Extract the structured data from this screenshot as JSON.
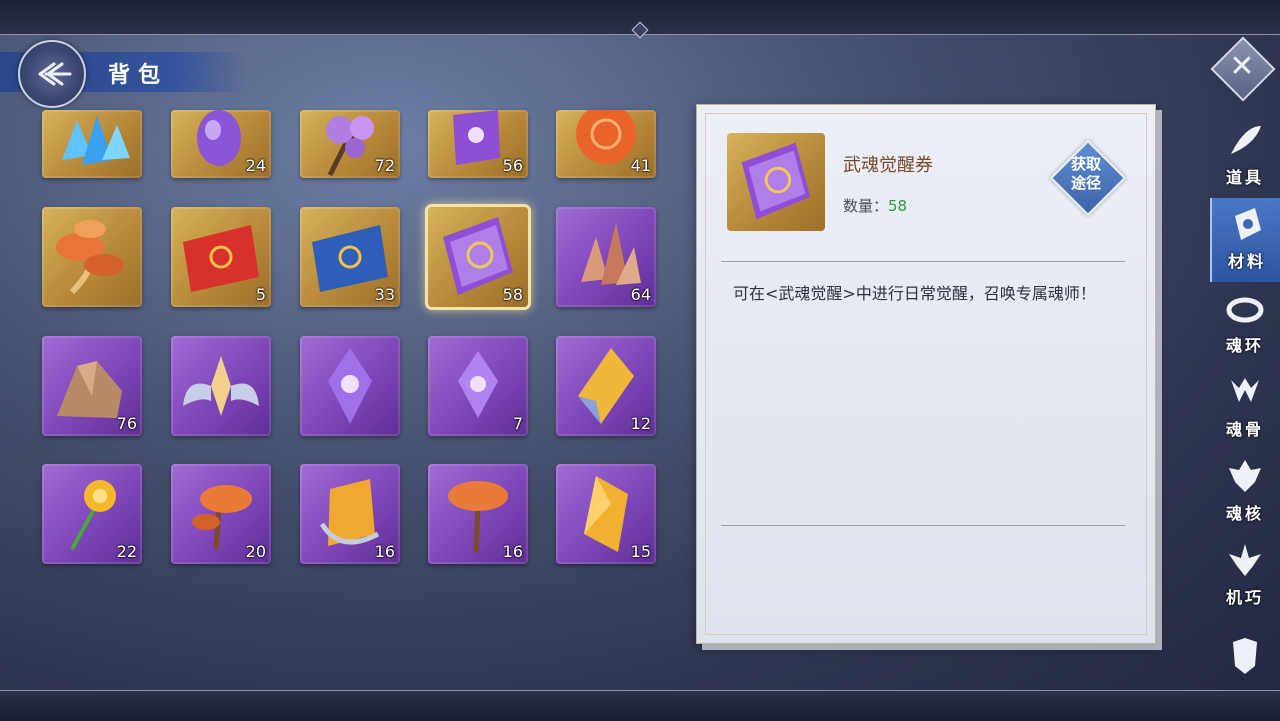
{
  "header": {
    "title": "背包"
  },
  "inventory": {
    "row0": [
      {
        "icon": "blue-crystal-cluster-icon",
        "count": "",
        "bg": "gold"
      },
      {
        "icon": "purple-gem-icon",
        "count": "24",
        "bg": "gold"
      },
      {
        "icon": "purple-flower-branch-icon",
        "count": "72",
        "bg": "gold"
      },
      {
        "icon": "purple-card-icon",
        "count": "56",
        "bg": "gold"
      },
      {
        "icon": "orange-orb-icon",
        "count": "41",
        "bg": "gold"
      }
    ],
    "row1": [
      {
        "icon": "mushroom-cluster-icon",
        "count": "",
        "bg": "gold"
      },
      {
        "icon": "red-scroll-icon",
        "count": "5",
        "bg": "gold"
      },
      {
        "icon": "blue-scroll-icon",
        "count": "33",
        "bg": "gold"
      },
      {
        "icon": "awakening-ticket-icon",
        "count": "58",
        "bg": "gold"
      },
      {
        "icon": "copper-crystal-icon",
        "count": "64",
        "bg": "purple"
      }
    ],
    "row2": [
      {
        "icon": "ore-rock-icon",
        "count": "76",
        "bg": "purple"
      },
      {
        "icon": "winged-emblem-icon",
        "count": "",
        "bg": "purple"
      },
      {
        "icon": "purple-shard-icon",
        "count": "",
        "bg": "purple"
      },
      {
        "icon": "purple-shard-small-icon",
        "count": "7",
        "bg": "purple"
      },
      {
        "icon": "golden-crystal-icon",
        "count": "12",
        "bg": "purple"
      }
    ],
    "row3": [
      {
        "icon": "golden-flower-icon",
        "count": "22",
        "bg": "purple"
      },
      {
        "icon": "lingzhi-mushroom-icon",
        "count": "20",
        "bg": "purple"
      },
      {
        "icon": "amber-crystal-icon",
        "count": "16",
        "bg": "purple"
      },
      {
        "icon": "single-mushroom-icon",
        "count": "16",
        "bg": "purple"
      },
      {
        "icon": "amber-gem-icon",
        "count": "15",
        "bg": "purple"
      }
    ]
  },
  "detail": {
    "name": "武魂觉醒券",
    "qty_label": "数量：",
    "qty_value": "58",
    "obtain_line1": "获取",
    "obtain_line2": "途径",
    "description": "可在<武魂觉醒>中进行日常觉醒，召唤专属魂师！"
  },
  "tabs": [
    {
      "label": "道具",
      "icon": "feather-icon"
    },
    {
      "label": "材料",
      "icon": "material-crystal-icon"
    },
    {
      "label": "魂环",
      "icon": "soul-ring-icon"
    },
    {
      "label": "魂骨",
      "icon": "soul-bone-icon"
    },
    {
      "label": "魂核",
      "icon": "soul-core-icon"
    },
    {
      "label": "机巧",
      "icon": "mechanism-icon"
    }
  ],
  "colors": {
    "gold_slot": "#c49a45",
    "purple_slot": "#8a4fc2",
    "active_tab": "#3c68b6",
    "qty_green": "#2e9a3a"
  }
}
